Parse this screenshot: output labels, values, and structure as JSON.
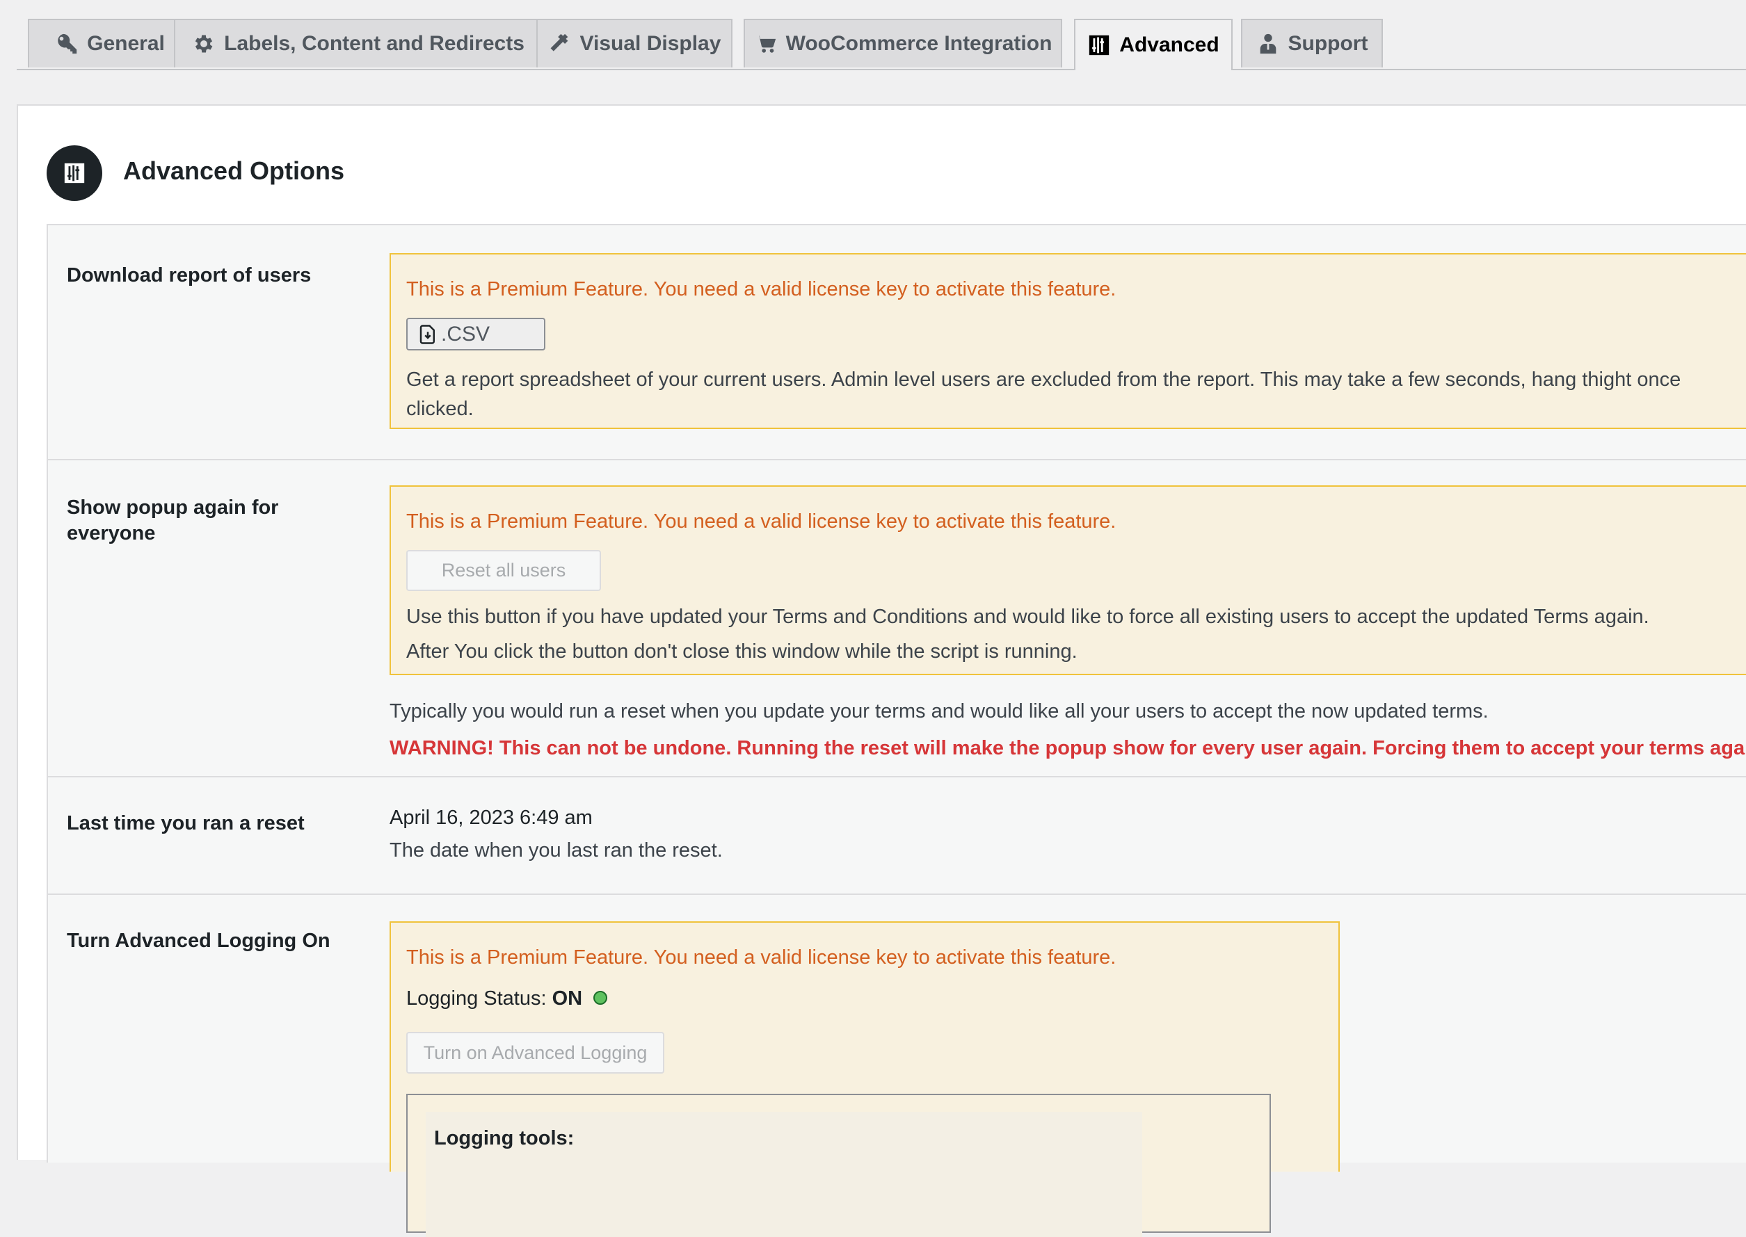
{
  "tabs": [
    {
      "label": "General",
      "icon": "key-icon",
      "active": false
    },
    {
      "label": "Labels, Content and Redirects",
      "icon": "gear-icon",
      "active": false
    },
    {
      "label": "Visual Display",
      "icon": "hammer-icon",
      "active": false
    },
    {
      "label": "WooCommerce Integration",
      "icon": "cart-icon",
      "active": false
    },
    {
      "label": "Advanced",
      "icon": "advanced-icon",
      "active": true
    },
    {
      "label": "Support",
      "icon": "person-icon",
      "active": false
    }
  ],
  "page": {
    "title": "Advanced Options",
    "icon": "advanced-icon"
  },
  "premium_message": "This is a Premium Feature. You need a valid license key to activate this feature.",
  "sections": {
    "download_report": {
      "label": "Download report of users",
      "button_label": ".CSV",
      "description": "Get a report spreadsheet of your current users. Admin level users are excluded from the report. This may take a few seconds, hang thight once clicked."
    },
    "show_popup": {
      "label": "Show popup again for everyone",
      "button_label": "Reset all users",
      "description_1": "Use this button if you have updated your Terms and Conditions and would like to force all existing users to accept the updated Terms again.",
      "description_2": "After You click the button don't close this window while the script is running.",
      "note": "Typically you would run a reset when you update your terms and would like all your users to accept the now updated terms.",
      "warning": "WARNING! This can not be undone. Running the reset will make the popup show for every user again. Forcing them to accept your terms again."
    },
    "last_reset": {
      "label": "Last time you ran a reset",
      "value": "April 16, 2023 6:49 am",
      "description": "The date when you last ran the reset."
    },
    "logging": {
      "label": "Turn Advanced Logging On",
      "status_label": "Logging Status:",
      "status_value": "ON",
      "button_label": "Turn on Advanced Logging",
      "tools_title": "Logging tools:"
    }
  },
  "colors": {
    "premium_text": "#d35f1f",
    "premium_bg": "#f8f1df",
    "premium_border": "#f0c33c",
    "warning": "#d63638",
    "status_on": "#5fc25f"
  }
}
